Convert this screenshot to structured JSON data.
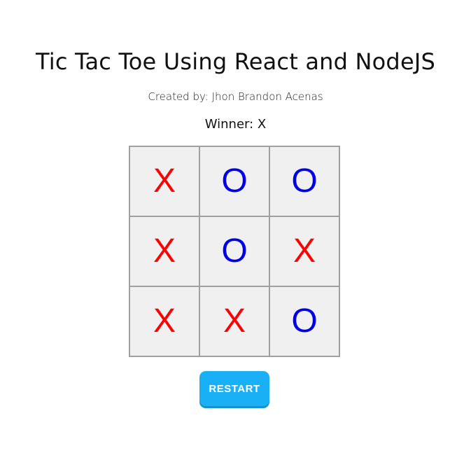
{
  "header": {
    "title": "Tic Tac Toe Using React and NodeJS",
    "credit": "Created by: Jhon Brandon Acenas"
  },
  "status": {
    "text": "Winner: X"
  },
  "board": {
    "cells": [
      "X",
      "O",
      "O",
      "X",
      "O",
      "X",
      "X",
      "X",
      "O"
    ]
  },
  "controls": {
    "restart_label": "RESTART"
  },
  "colors": {
    "x_mark": "#ff0000",
    "o_mark": "#0000e6",
    "restart_button": "#1ab0f5"
  }
}
